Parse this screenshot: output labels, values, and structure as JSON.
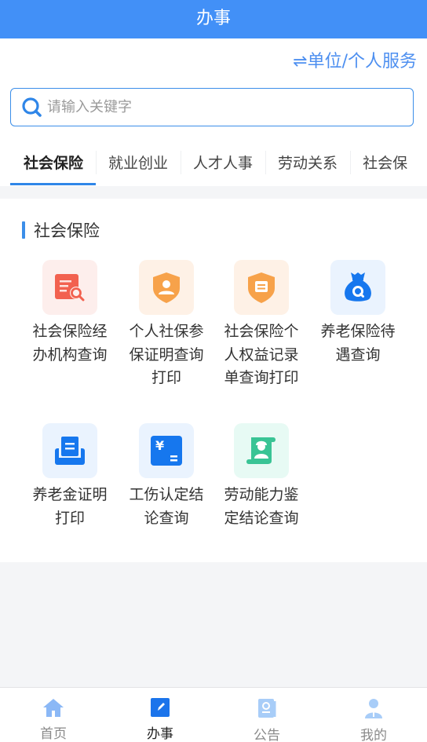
{
  "header": {
    "title": "办事"
  },
  "switch_link": {
    "label": "⇌单位/个人服务"
  },
  "search": {
    "placeholder": "请输入关键字",
    "value": ""
  },
  "tabs": [
    {
      "label": "社会保险",
      "active": true
    },
    {
      "label": "就业创业",
      "active": false
    },
    {
      "label": "人才人事",
      "active": false
    },
    {
      "label": "劳动关系",
      "active": false
    },
    {
      "label": "社会保",
      "active": false
    }
  ],
  "section": {
    "title": "社会保险",
    "services": [
      {
        "label": "社会保险经办机构查询",
        "icon": "document-search-icon",
        "color": "#f2614f",
        "bg": "#fdeeec"
      },
      {
        "label": "个人社保参保证明查询打印",
        "icon": "shield-user-icon",
        "color": "#f7a24a",
        "bg": "#fef1e6"
      },
      {
        "label": "社会保险个人权益记录单查询打印",
        "icon": "shield-document-icon",
        "color": "#f7a24a",
        "bg": "#fef1e6"
      },
      {
        "label": "养老保险待遇查询",
        "icon": "money-bag-search-icon",
        "color": "#1677ee",
        "bg": "#eaf3fe"
      },
      {
        "label": "养老金证明打印",
        "icon": "printer-icon",
        "color": "#1677ee",
        "bg": "#eaf3fe"
      },
      {
        "label": "工伤认定结论查询",
        "icon": "yuan-card-icon",
        "color": "#1677ee",
        "bg": "#eaf3fe"
      },
      {
        "label": "劳动能力鉴定结论查询",
        "icon": "worker-scroll-icon",
        "color": "#39c495",
        "bg": "#e7faf4"
      }
    ]
  },
  "bottom_nav": [
    {
      "label": "首页",
      "icon": "home-icon",
      "active": false
    },
    {
      "label": "办事",
      "icon": "edit-icon",
      "active": true
    },
    {
      "label": "公告",
      "icon": "notice-book-icon",
      "active": false
    },
    {
      "label": "我的",
      "icon": "user-icon",
      "active": false
    }
  ],
  "colors": {
    "primary": "#4290f7",
    "accent": "#2f86e8"
  }
}
